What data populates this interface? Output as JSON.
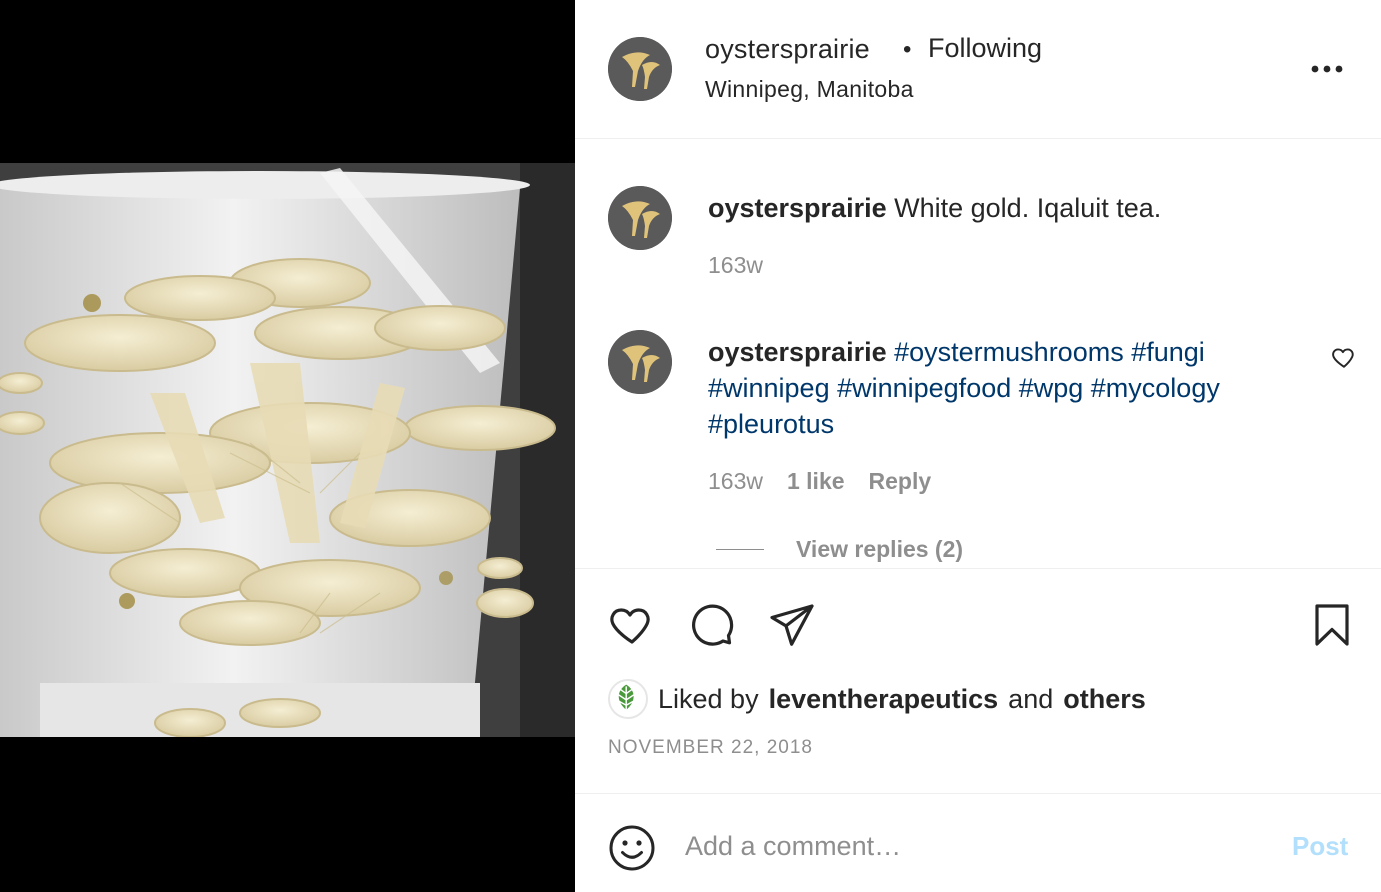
{
  "post": {
    "username": "oystersprairie",
    "separator": "•",
    "follow_status": "Following",
    "location": "Winnipeg, Manitoba"
  },
  "comments": [
    {
      "username": "oystersprairie",
      "text": "White gold. Iqaluit tea.",
      "age": "163w"
    },
    {
      "username": "oystersprairie",
      "hashtags_line1": "#oystermushrooms #fungi",
      "hashtags_line2": "#winnipeg #winnipegfood #wpg #mycology",
      "hashtags_line3": "#pleurotus",
      "age": "163w",
      "likes": "1 like",
      "reply_label": "Reply",
      "view_replies": "View replies (2)"
    }
  ],
  "actions": {
    "like_icon": "heart-icon",
    "comment_icon": "comment-icon",
    "share_icon": "send-icon",
    "save_icon": "bookmark-icon"
  },
  "likes": {
    "prefix": "Liked by",
    "liker": "leventherapeutics",
    "conjunction": "and",
    "others": "others"
  },
  "date": "NOVEMBER 22, 2018",
  "add_comment": {
    "placeholder": "Add a comment…",
    "post_label": "Post"
  },
  "colors": {
    "hashtag": "#00376b",
    "secondary_text": "#8e8e8e",
    "post_disabled": "#b2dffc",
    "avatar_bg": "#5a5a5a",
    "logo_gold": "#e0c37a"
  }
}
